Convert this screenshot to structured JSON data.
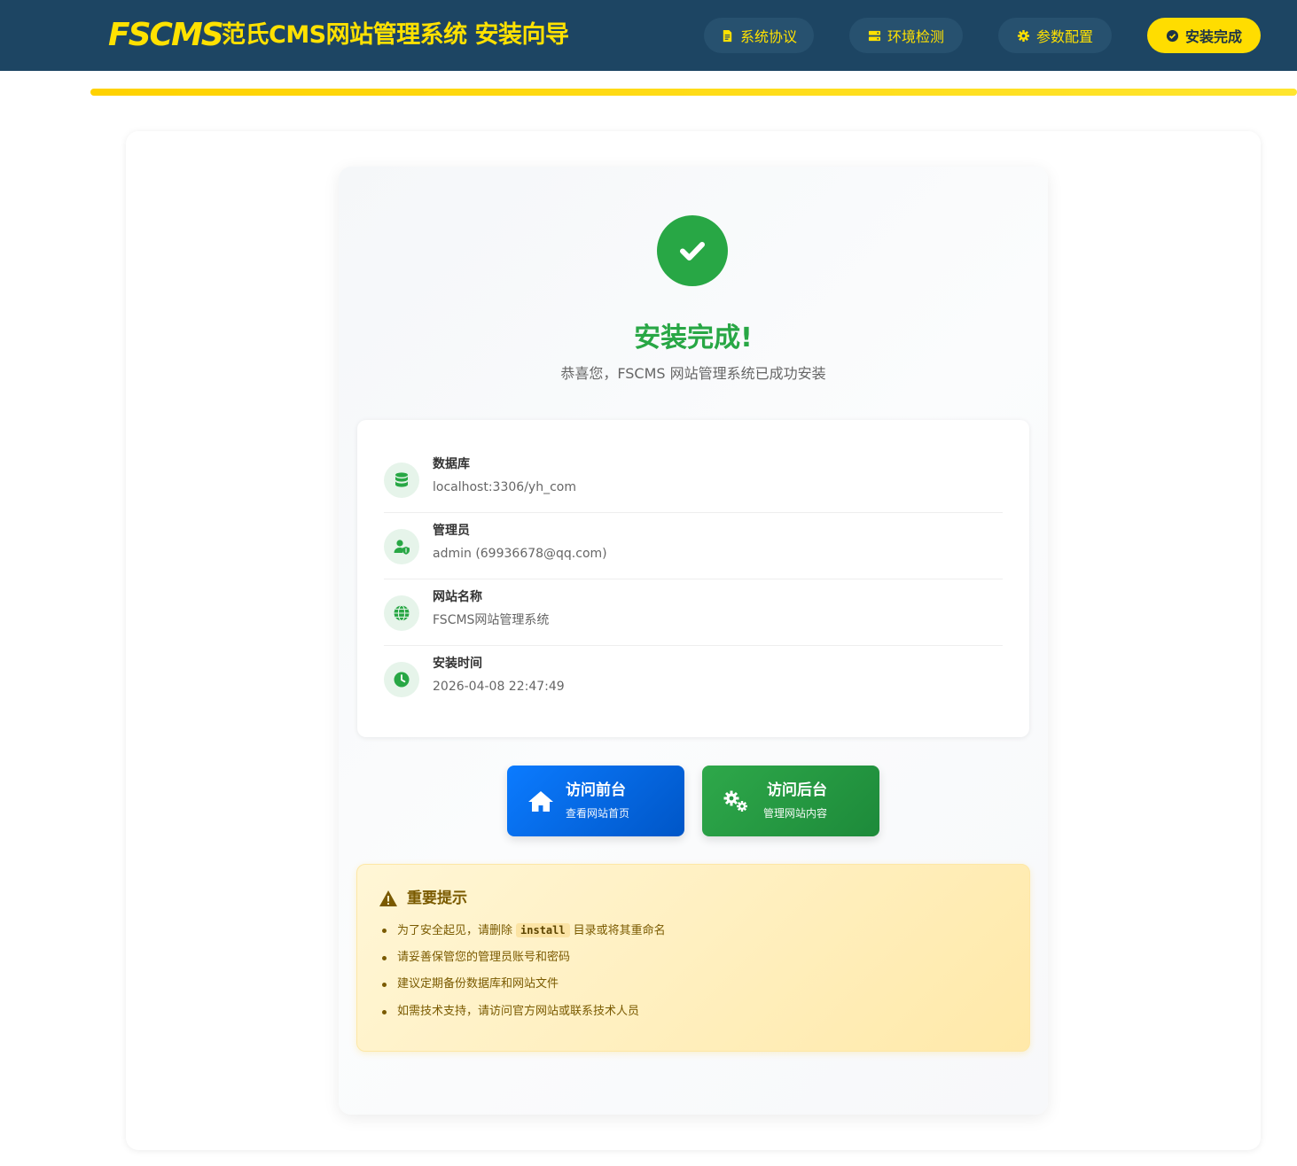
{
  "header": {
    "logo": "FSCMS",
    "title": "范氏CMS网站管理系统 安装向导",
    "steps": [
      {
        "label": "系统协议",
        "icon": "file-contract-icon"
      },
      {
        "label": "环境检测",
        "icon": "server-icon"
      },
      {
        "label": "参数配置",
        "icon": "gear-icon"
      },
      {
        "label": "安装完成",
        "icon": "check-circle-icon"
      }
    ],
    "active_step": 3
  },
  "progress": {
    "percent": 100
  },
  "success": {
    "title": "安装完成!",
    "subtitle": "恭喜您，FSCMS 网站管理系统已成功安装"
  },
  "info": [
    {
      "label": "数据库",
      "value": "localhost:3306/yh_com",
      "icon": "database-icon"
    },
    {
      "label": "管理员",
      "value": "admin (69936678@qq.com)",
      "icon": "user-shield-icon"
    },
    {
      "label": "网站名称",
      "value": "FSCMS网站管理系统",
      "icon": "globe-icon"
    },
    {
      "label": "安装时间",
      "value": "2026-04-08 22:47:49",
      "icon": "clock-icon"
    }
  ],
  "buttons": {
    "front": {
      "title": "访问前台",
      "subtitle": "查看网站首页",
      "icon": "home-icon"
    },
    "back": {
      "title": "访问后台",
      "subtitle": "管理网站内容",
      "icon": "gears-icon"
    }
  },
  "notice": {
    "title": "重要提示",
    "item1_before": "为了安全起见，请删除",
    "item1_code": "install",
    "item1_after": "目录或将其重命名",
    "items": [
      "请妥善保管您的管理员账号和密码",
      "建议定期备份数据库和网站文件",
      "如需技术支持，请访问官方网站或联系技术人员"
    ]
  },
  "colors": {
    "header_bg": "#1d4563",
    "accent_yellow": "#ffdd00",
    "success_green": "#28a745",
    "primary_blue": "#0b7bff"
  }
}
